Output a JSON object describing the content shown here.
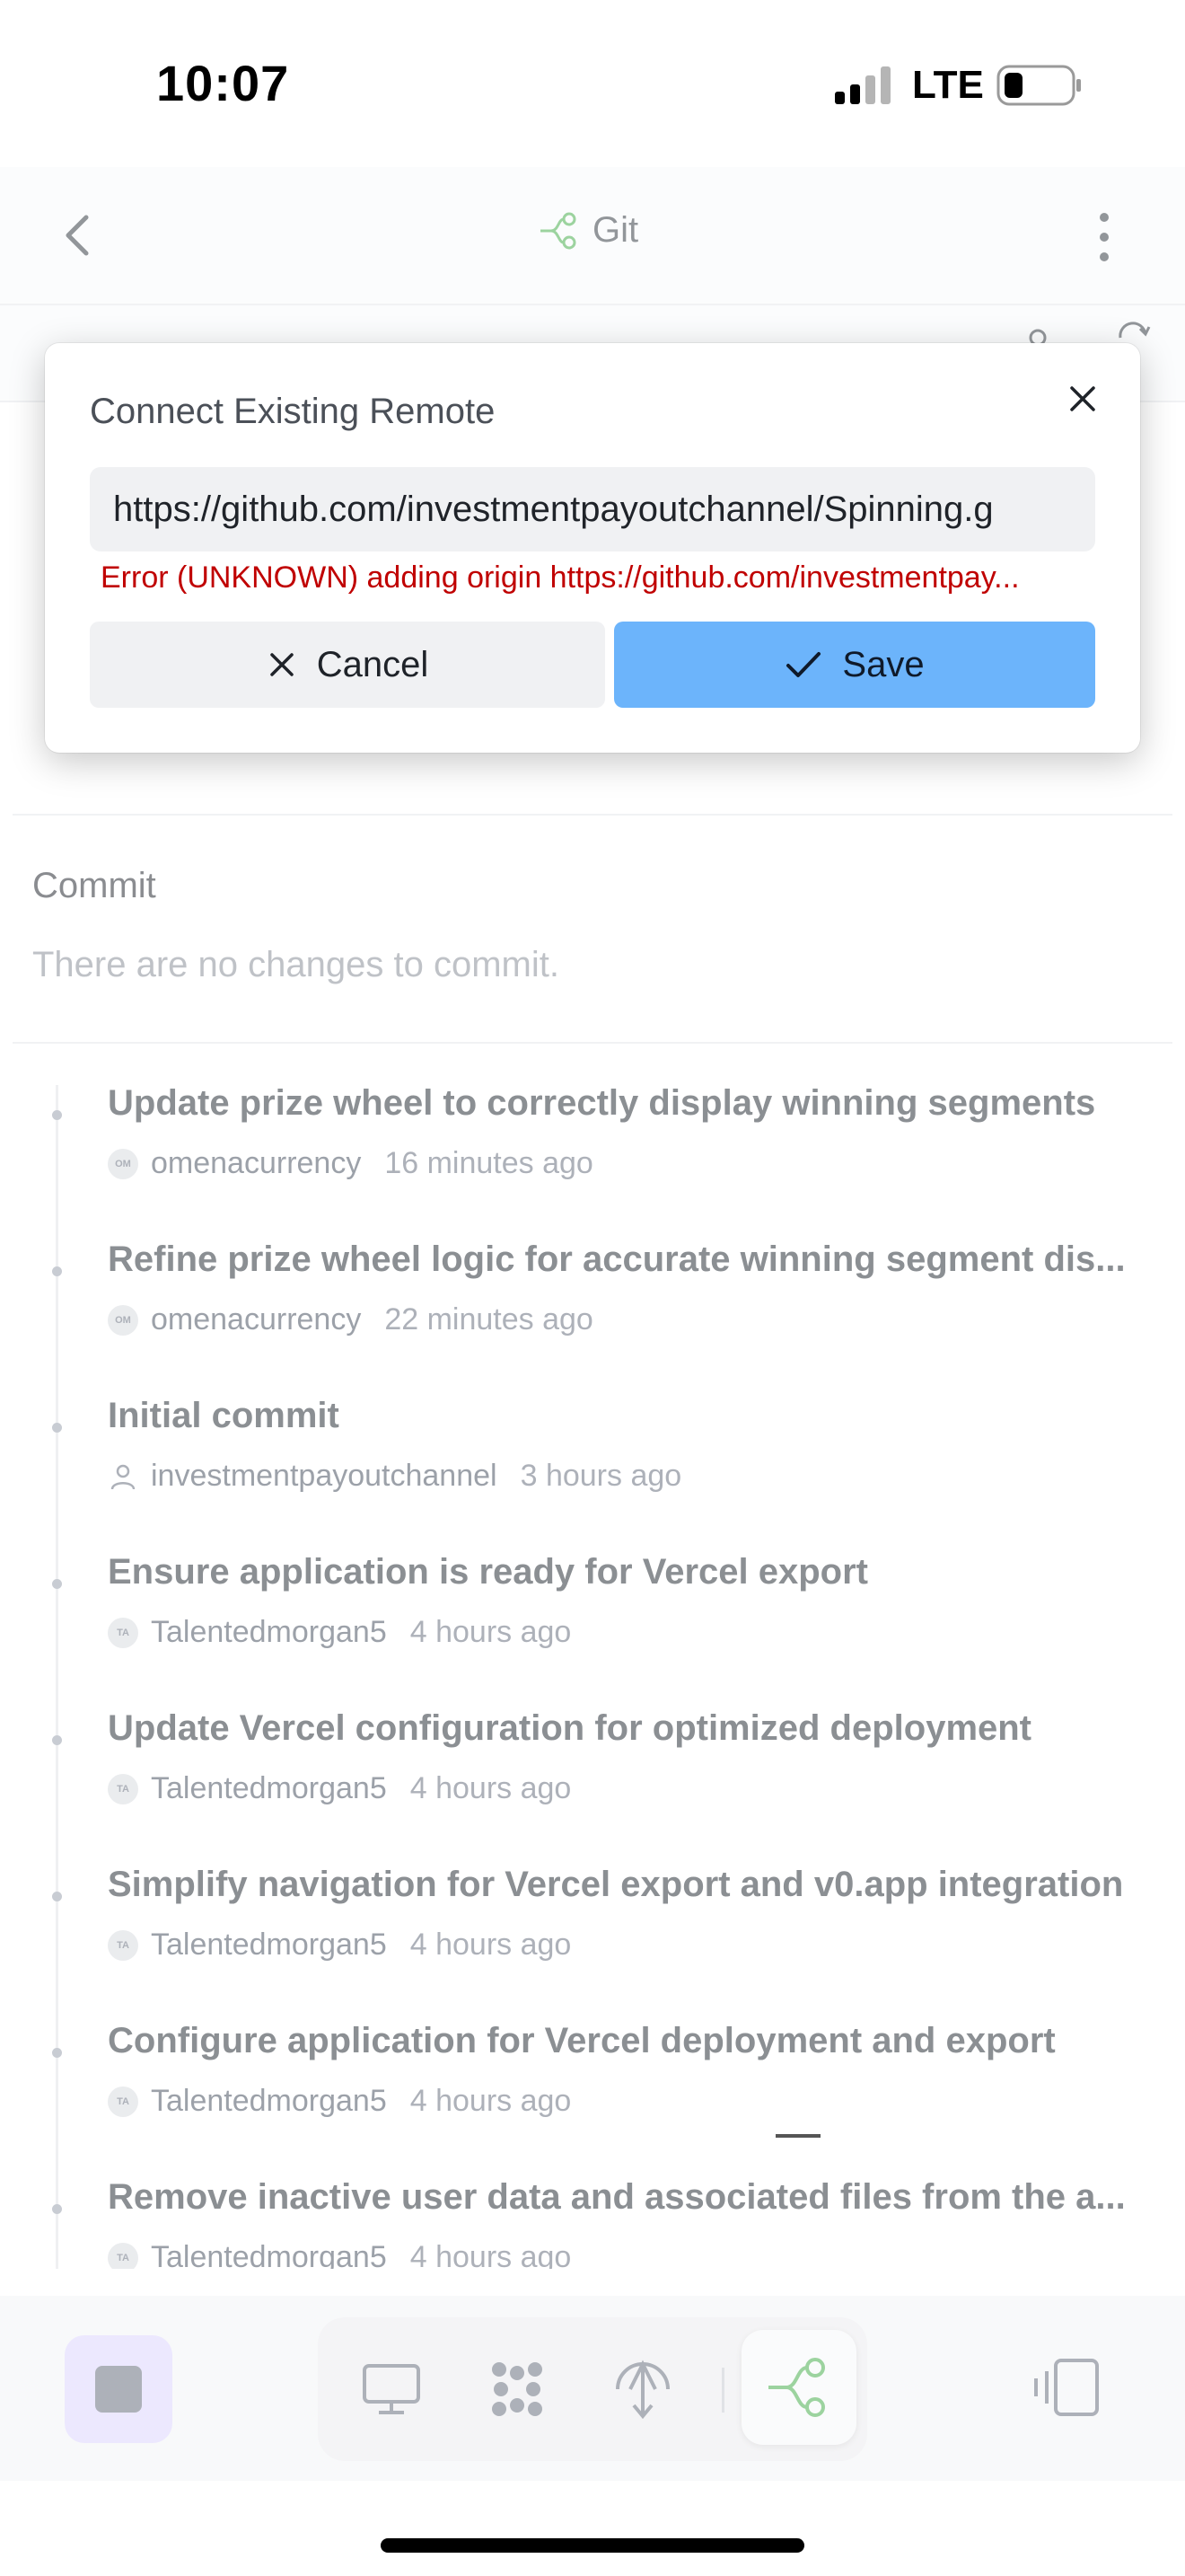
{
  "status_bar": {
    "time": "10:07",
    "network": "LTE"
  },
  "header": {
    "title": "Git",
    "back_icon": "chevron-left-icon",
    "more_icon": "more-vertical-icon"
  },
  "commit_section": {
    "heading": "Commit",
    "empty_message": "There are no changes to commit."
  },
  "commits": [
    {
      "title": "Update prize wheel to correctly display winning segments",
      "author": "omenacurrency",
      "avatar": "OM",
      "time": "16 minutes ago"
    },
    {
      "title": "Refine prize wheel logic for accurate winning segment dis...",
      "author": "omenacurrency",
      "avatar": "OM",
      "time": "22 minutes ago"
    },
    {
      "title": "Initial commit",
      "author": "investmentpayoutchannel",
      "avatar": "",
      "time": "3 hours ago"
    },
    {
      "title": "Ensure application is ready for Vercel export",
      "author": "Talentedmorgan5",
      "avatar": "TA",
      "time": "4 hours ago"
    },
    {
      "title": "Update Vercel configuration for optimized deployment",
      "author": "Talentedmorgan5",
      "avatar": "TA",
      "time": "4 hours ago"
    },
    {
      "title": "Simplify navigation for Vercel export and v0.app integration",
      "author": "Talentedmorgan5",
      "avatar": "TA",
      "time": "4 hours ago"
    },
    {
      "title": "Configure application for Vercel deployment and export",
      "author": "Talentedmorgan5",
      "avatar": "TA",
      "time": "4 hours ago"
    },
    {
      "title": "Remove inactive user data and associated files from the a...",
      "author": "Talentedmorgan5",
      "avatar": "TA",
      "time": "4 hours ago"
    }
  ],
  "dialog": {
    "title": "Connect Existing Remote",
    "input_value": "https://github.com/investmentpayoutchannel/Spinning.g",
    "error": "Error (UNKNOWN) adding origin https://github.com/investmentpay...",
    "cancel_label": "Cancel",
    "save_label": "Save"
  },
  "colors": {
    "accent": "#6cb4fb",
    "error": "#c00000",
    "git_green": "#4caf50",
    "stop_bg": "#ddd6fe"
  }
}
